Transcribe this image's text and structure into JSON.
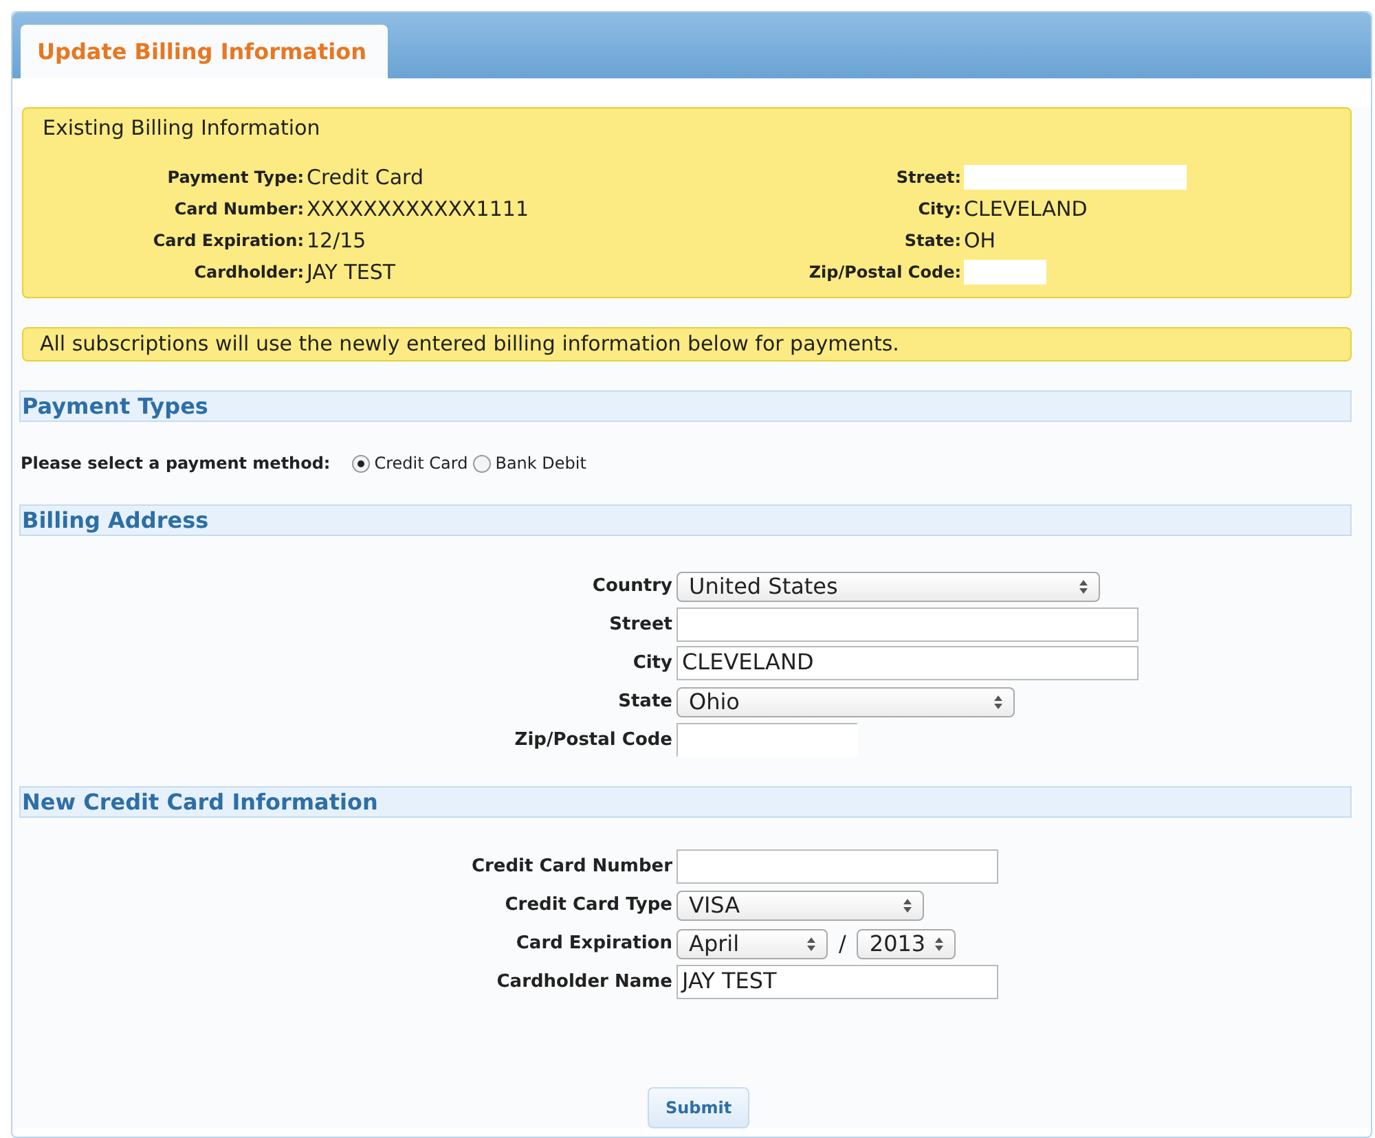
{
  "tab": {
    "label": "Update Billing Information",
    "selected": true
  },
  "existing": {
    "title": "Existing Billing Information",
    "left": [
      {
        "label": "Payment Type:",
        "value": "Credit Card"
      },
      {
        "label": "Card Number:",
        "value": "XXXXXXXXXXXX1111"
      },
      {
        "label": "Card Expiration:",
        "value": "12/15"
      },
      {
        "label": "Cardholder:",
        "value": "JAY TEST"
      }
    ],
    "right": [
      {
        "label": "Street:"
      },
      {
        "label": "City:",
        "value": "CLEVELAND"
      },
      {
        "label": "State:",
        "value": "OH"
      },
      {
        "label": "Zip/Postal Code:"
      }
    ]
  },
  "notice": "All subscriptions will use the newly entered billing information below for payments.",
  "payment_types": {
    "title": "Payment Types",
    "prompt": "Please select a payment method:",
    "options": [
      {
        "label": "Credit Card",
        "selected": true
      },
      {
        "label": "Bank Debit",
        "selected": false
      }
    ]
  },
  "billing_address": {
    "title": "Billing Address",
    "fields": [
      {
        "kind": "select",
        "label": "Country",
        "value": "United States"
      },
      {
        "kind": "text",
        "label": "Street"
      },
      {
        "kind": "text",
        "label": "City",
        "value": "CLEVELAND"
      },
      {
        "kind": "select",
        "label": "State",
        "value": "Ohio"
      },
      {
        "kind": "text",
        "label": "Zip/Postal Code"
      }
    ]
  },
  "credit_card": {
    "title": "New Credit Card Information",
    "fields": [
      {
        "kind": "text",
        "label": "Credit Card Number"
      },
      {
        "kind": "select",
        "label": "Credit Card Type",
        "value": "VISA"
      },
      {
        "kind": "expiry",
        "label": "Card Expiration",
        "month": "April",
        "separator": "/",
        "year": "2013"
      },
      {
        "kind": "text",
        "label": "Cardholder Name",
        "value": "JAY TEST"
      }
    ]
  },
  "submit": "Submit"
}
